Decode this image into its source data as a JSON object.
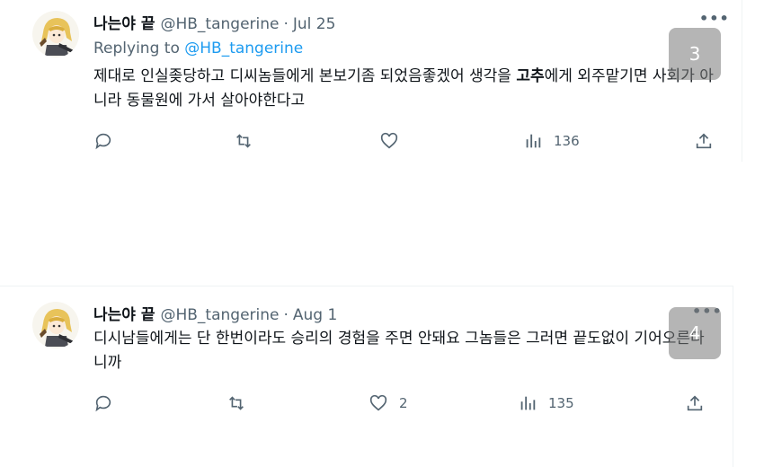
{
  "tweets": [
    {
      "name": "나는야 끝",
      "handle": "@HB_tangerine",
      "separator": "·",
      "date": "Jul 25",
      "replying_prefix": "Replying to",
      "replying_to": "@HB_tangerine",
      "text_before": "제대로 인실좆당하고 디씨놈들에게 본보기좀 되었음좋겠어 생각을 ",
      "text_bold": "고추",
      "text_after": "에게 외주맡기면 사회가 아니라 동물원에 가서 살아야한다고",
      "replies": "",
      "retweets": "",
      "likes": "",
      "views": "136",
      "more": "•••"
    },
    {
      "name": "나는야 끝",
      "handle": "@HB_tangerine",
      "separator": "·",
      "date": "Aug 1",
      "text": "디시남들에게는 단 한번이라도 승리의 경험을 주면 안돼요 그놈들은 그러면 끝도없이 기어오른다니까",
      "replies": "",
      "retweets": "",
      "likes": "2",
      "views": "135",
      "more": "•••"
    }
  ],
  "badges": [
    "3",
    "4"
  ],
  "icons": {
    "avatar": "anime-avatar-icon",
    "reply": "reply-icon",
    "retweet": "retweet-icon",
    "like": "heart-icon",
    "views": "views-icon",
    "share": "share-icon",
    "more": "more-icon"
  },
  "colors": {
    "link": "#1d9bf0",
    "secondary_text": "#536471",
    "primary_text": "#0f1419",
    "divider": "#eff3f4",
    "badge_bg": "rgba(120,120,120,0.55)"
  }
}
